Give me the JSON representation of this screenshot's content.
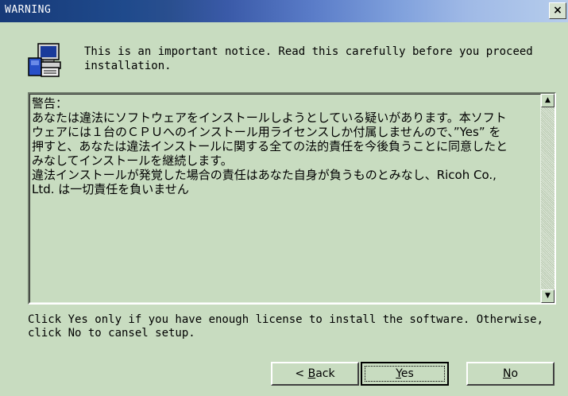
{
  "window": {
    "title": "WARNING",
    "close_label": "×"
  },
  "notice": {
    "text": "This is an important notice. Read this carefully before you proceed installation."
  },
  "warning_box": {
    "text": "警告：\nあなたは違法にソフトウェアをインストールしようとしている疑いがあります。本ソフトウェアには１台のＣＰＵへのインストール用ライセンスしか付属しませんので、”Yes” を押すと、あなたは違法インストールに関する全ての法的責任を今後負うことに同意したとみなしてインストールを継続します。\n違法インストールが発覚した場合の責任はあなた自身が負うものとみなし、Ricoh Co., Ltd. は一切責任を負いません",
    "scroll_up": "▲",
    "scroll_down": "▼"
  },
  "footer": {
    "text": "Click Yes only if you have enough license to install the software. Otherwise, click No to cansel setup."
  },
  "buttons": {
    "back_prefix": "< ",
    "back_mnemonic": "B",
    "back_rest": "ack",
    "yes_mnemonic": "Y",
    "yes_rest": "es",
    "no_mnemonic": "N",
    "no_rest": "o"
  },
  "icons": {
    "installer": "computer-install-icon",
    "close": "close-icon"
  }
}
